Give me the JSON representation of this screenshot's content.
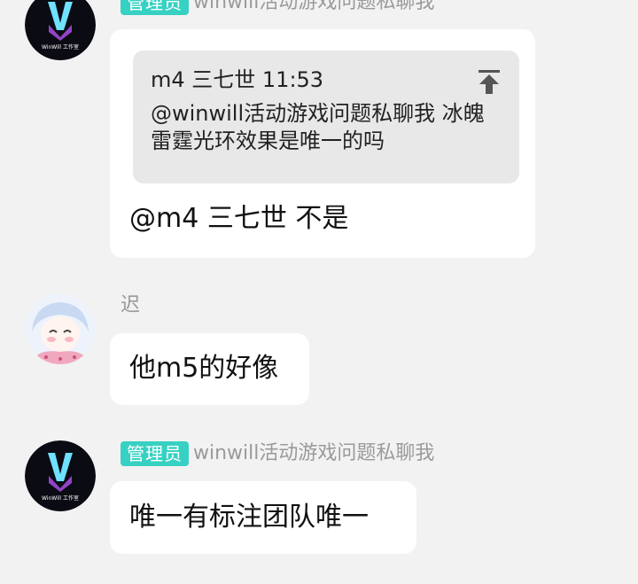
{
  "messages": [
    {
      "sender": {
        "badge": "管理员",
        "name": "winwill活动游戏问题私聊我",
        "avatar_text": "WinWill 工作室"
      },
      "quote": {
        "header": "m4 三七世 11:53",
        "body": "@winwill活动游戏问题私聊我 冰魄雷霆光环效果是唯一的吗",
        "icon": "scroll-to-top-icon"
      },
      "text": "@m4 三七世 不是"
    },
    {
      "sender": {
        "name": "迟"
      },
      "text": "他m5的好像"
    },
    {
      "sender": {
        "badge": "管理员",
        "name": "winwill活动游戏问题私聊我",
        "avatar_text": "WinWill 工作室"
      },
      "text": "唯一有标注团队唯一"
    }
  ],
  "colors": {
    "background": "#f2f2f2",
    "bubble": "#ffffff",
    "quote": "#e8e8e8",
    "badge": "#36d1c3",
    "sender_name": "#9a9a9a"
  }
}
